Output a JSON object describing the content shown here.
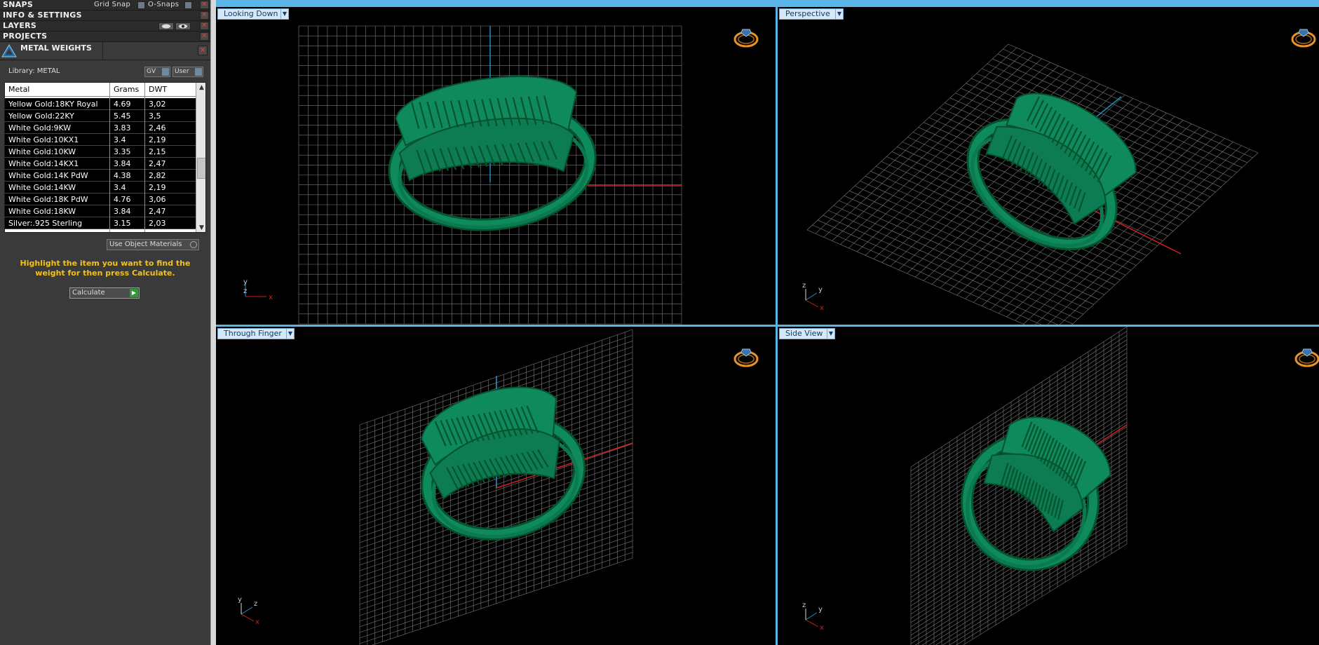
{
  "panel": {
    "headers": {
      "snaps": "SNAPS",
      "info": "INFO & SETTINGS",
      "layers": "LAYERS",
      "projects": "PROJECTS"
    },
    "grid_snap": "Grid Snap",
    "o_snaps": "O-Snaps",
    "close_glyph": "✕",
    "metal_weights": {
      "title": "METAL WEIGHTS",
      "library_label": "Library: METAL",
      "btn_gv": "GV",
      "btn_user": "User",
      "table": {
        "headers": [
          "Metal",
          "Grams",
          "DWT"
        ],
        "rows": [
          [
            "Yellow Gold:18KY Royal",
            "4.69",
            "3,02"
          ],
          [
            "Yellow Gold:22KY",
            "5.45",
            "3,5"
          ],
          [
            "White Gold:9KW",
            "3.83",
            "2,46"
          ],
          [
            "White Gold:10KX1",
            "3.4",
            "2,19"
          ],
          [
            "White Gold:10KW",
            "3.35",
            "2,15"
          ],
          [
            "White Gold:14KX1",
            "3.84",
            "2,47"
          ],
          [
            "White Gold:14K PdW",
            "4.38",
            "2,82"
          ],
          [
            "White Gold:14KW",
            "3.4",
            "2,19"
          ],
          [
            "White Gold:18K PdW",
            "4.76",
            "3,06"
          ],
          [
            "White Gold:18KW",
            "3.84",
            "2,47"
          ],
          [
            "Silver:.925 Sterling",
            "3.15",
            "2,03"
          ]
        ]
      },
      "use_object_materials": "Use Object Materials",
      "hint": "Highlight the item you want to find the weight for then press Calculate.",
      "calculate": "Calculate"
    }
  },
  "viewports": [
    {
      "label": "Looking Down",
      "axis": [
        "y",
        "z",
        "x"
      ]
    },
    {
      "label": "Perspective",
      "axis": [
        "z",
        "y",
        "x"
      ]
    },
    {
      "label": "Through Finger",
      "axis": [
        "y",
        "z",
        "x"
      ]
    },
    {
      "label": "Side View",
      "axis": [
        "z",
        "y",
        "x"
      ]
    }
  ],
  "colors": {
    "accent": "#5ab4e6",
    "ring": "#0f8a5c",
    "ring_dark": "#05532f",
    "grid": "#8a8a8a",
    "axis_red": "#d02020",
    "axis_blue": "#1e90c8",
    "hint": "#f2c21b",
    "nav_ring": "#e7922a"
  }
}
